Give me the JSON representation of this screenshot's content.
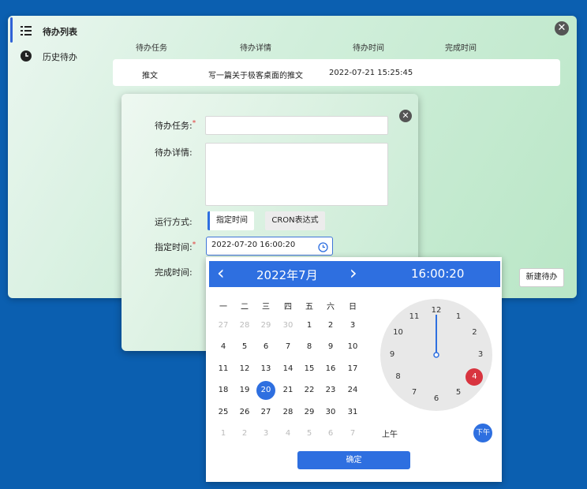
{
  "sidebar": {
    "items": [
      {
        "label": "待办列表",
        "icon": "list-icon"
      },
      {
        "label": "历史待办",
        "icon": "clock-icon"
      }
    ]
  },
  "table": {
    "headers": [
      "待办任务",
      "待办详情",
      "待办时间",
      "完成时间"
    ],
    "rows": [
      {
        "task": "推文",
        "detail": "写一篇关于极客桌面的推文",
        "time": "2022-07-21 15:25:45",
        "done": ""
      }
    ]
  },
  "toolbar": {
    "new_label": "新建待办"
  },
  "dialog": {
    "task_label": "待办任务:",
    "detail_label": "待办详情:",
    "mode_label": "运行方式:",
    "time_label": "指定时间:",
    "done_label": "完成时间:",
    "mode_options": [
      "指定时间",
      "CRON表达式"
    ],
    "time_value": "2022-07-20 16:00:20",
    "required_mark": "*"
  },
  "picker": {
    "prev": "‹",
    "next": "›",
    "month_title": "2022年7月",
    "time_display": "16:00:20",
    "weekdays": [
      "一",
      "二",
      "三",
      "四",
      "五",
      "六",
      "日"
    ],
    "days": [
      [
        {
          "d": "27",
          "dim": true
        },
        {
          "d": "28",
          "dim": true
        },
        {
          "d": "29",
          "dim": true
        },
        {
          "d": "30",
          "dim": true
        },
        {
          "d": "1"
        },
        {
          "d": "2"
        },
        {
          "d": "3"
        }
      ],
      [
        {
          "d": "4"
        },
        {
          "d": "5"
        },
        {
          "d": "6"
        },
        {
          "d": "7"
        },
        {
          "d": "8"
        },
        {
          "d": "9"
        },
        {
          "d": "10"
        }
      ],
      [
        {
          "d": "11"
        },
        {
          "d": "12"
        },
        {
          "d": "13"
        },
        {
          "d": "14"
        },
        {
          "d": "15"
        },
        {
          "d": "16"
        },
        {
          "d": "17"
        }
      ],
      [
        {
          "d": "18"
        },
        {
          "d": "19"
        },
        {
          "d": "20",
          "sel": true
        },
        {
          "d": "21"
        },
        {
          "d": "22"
        },
        {
          "d": "23"
        },
        {
          "d": "24"
        }
      ],
      [
        {
          "d": "25"
        },
        {
          "d": "26"
        },
        {
          "d": "27"
        },
        {
          "d": "28"
        },
        {
          "d": "29"
        },
        {
          "d": "30"
        },
        {
          "d": "31"
        }
      ],
      [
        {
          "d": "1",
          "dim": true
        },
        {
          "d": "2",
          "dim": true
        },
        {
          "d": "3",
          "dim": true
        },
        {
          "d": "4",
          "dim": true
        },
        {
          "d": "5",
          "dim": true
        },
        {
          "d": "6",
          "dim": true
        },
        {
          "d": "7",
          "dim": true
        }
      ]
    ],
    "clock_numbers": [
      "12",
      "1",
      "2",
      "3",
      "4",
      "5",
      "6",
      "7",
      "8",
      "9",
      "10",
      "11"
    ],
    "selected_hour": "4",
    "am_label": "上午",
    "pm_label": "下午",
    "ok_label": "确定"
  },
  "colors": {
    "accent": "#2e6fe0",
    "required": "#e23a3a",
    "selected_hour": "#d8343f"
  }
}
